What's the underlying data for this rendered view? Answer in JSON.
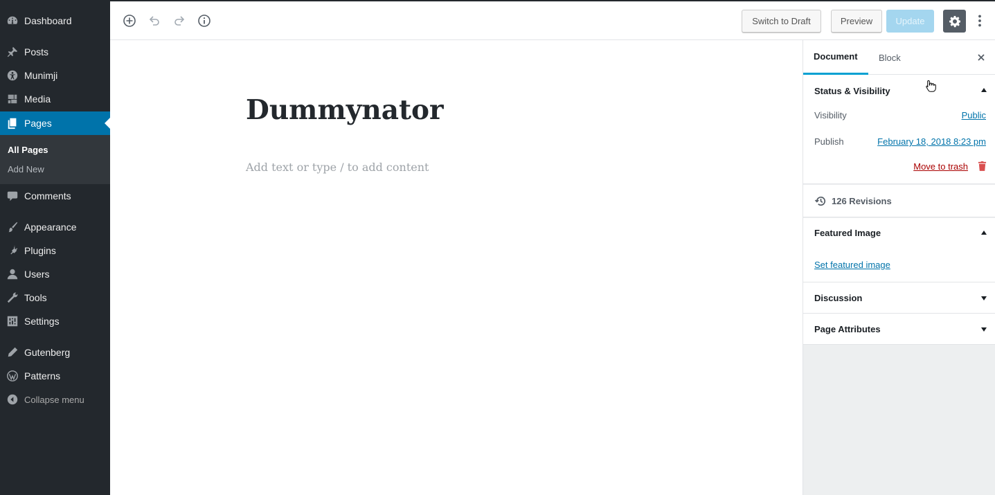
{
  "admin_menu": {
    "items": [
      {
        "label": "Dashboard"
      },
      {
        "label": "Posts"
      },
      {
        "label": "Munimji"
      },
      {
        "label": "Media"
      },
      {
        "label": "Pages"
      },
      {
        "label": "Comments"
      },
      {
        "label": "Appearance"
      },
      {
        "label": "Plugins"
      },
      {
        "label": "Users"
      },
      {
        "label": "Tools"
      },
      {
        "label": "Settings"
      },
      {
        "label": "Gutenberg"
      },
      {
        "label": "Patterns"
      }
    ],
    "submenu": [
      "All Pages",
      "Add New"
    ],
    "collapse_label": "Collapse menu",
    "accent_color": "#0073aa"
  },
  "toolbar": {
    "switch_to_draft": "Switch to Draft",
    "preview": "Preview",
    "update": "Update",
    "update_color": "#a4d6ef"
  },
  "editor": {
    "title": "Dummynator",
    "placeholder": "Add text or type / to add content"
  },
  "sidebar": {
    "tabs": [
      "Document",
      "Block"
    ],
    "status": {
      "title": "Status & Visibility",
      "visibility_label": "Visibility",
      "visibility_value": "Public",
      "publish_label": "Publish",
      "publish_value": "February 18, 2018 8:23 pm",
      "trash": "Move to trash"
    },
    "revisions": "126 Revisions",
    "featured_image": {
      "title": "Featured Image",
      "link": "Set featured image"
    },
    "discussion": "Discussion",
    "page_attributes": "Page Attributes"
  }
}
